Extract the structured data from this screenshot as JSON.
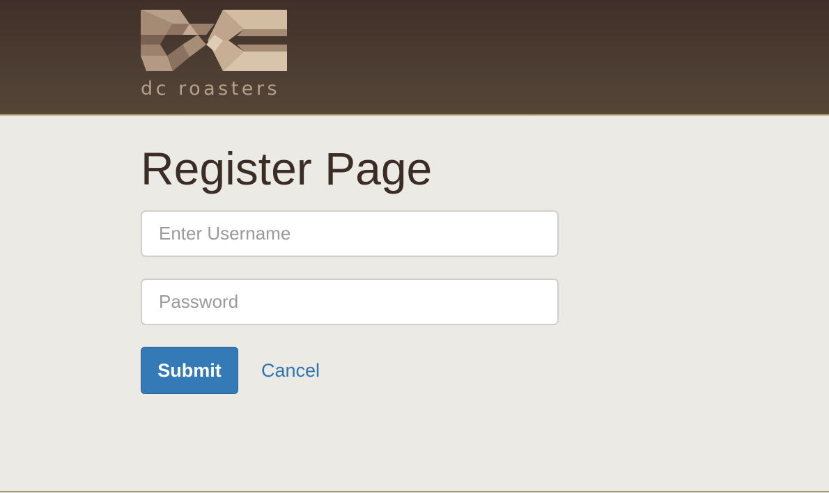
{
  "header": {
    "logo_text": "dc roasters"
  },
  "main": {
    "title": "Register Page",
    "username": {
      "placeholder": "Enter Username",
      "value": ""
    },
    "password": {
      "placeholder": "Password",
      "value": ""
    },
    "submit_label": "Submit",
    "cancel_label": "Cancel"
  },
  "colors": {
    "header_dark": "#3f2f28",
    "header_accent": "#a8966f",
    "page_bg": "#ebeae5",
    "primary": "#337ab7",
    "link": "#2f74b3",
    "title_text": "#3b2c25"
  },
  "icons": {
    "logo": "dc-roasters-logo-icon"
  }
}
